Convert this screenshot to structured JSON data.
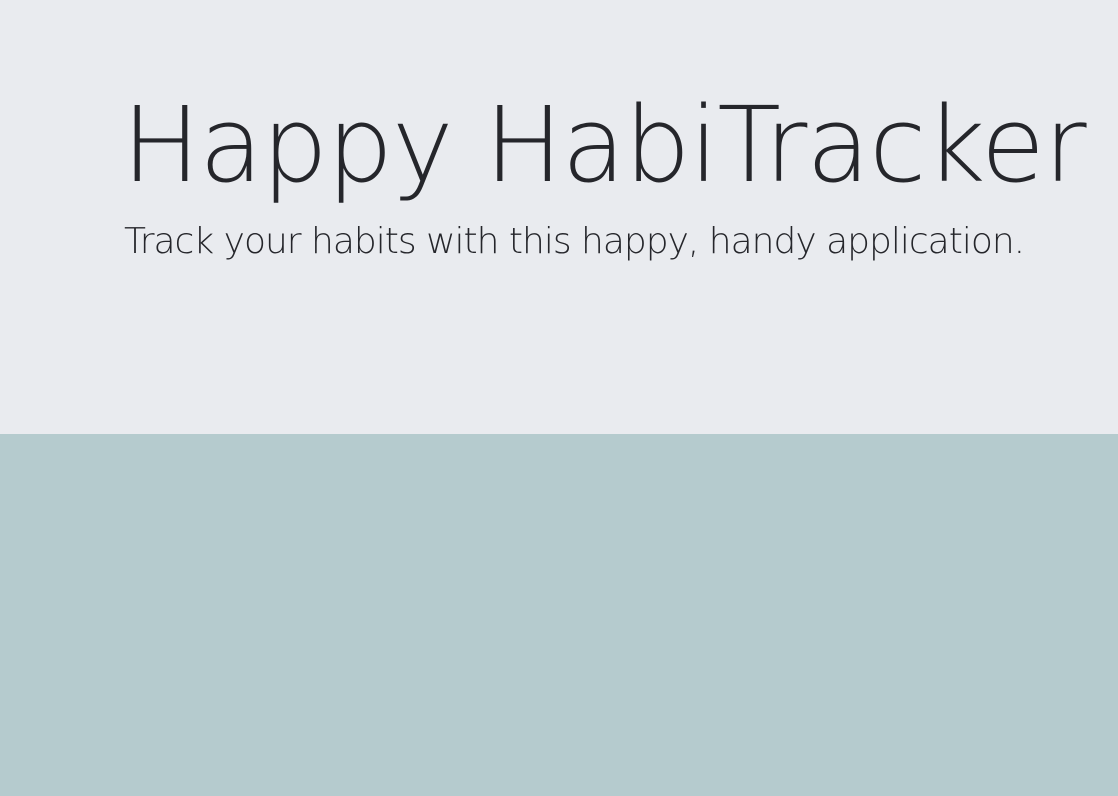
{
  "hero": {
    "title": "Happy HabiTracker",
    "subtitle": "Track your habits with this happy, handy application."
  },
  "colors": {
    "hero_background": "#e9ebef",
    "content_background": "#b5cbce",
    "text": "#25262b"
  }
}
